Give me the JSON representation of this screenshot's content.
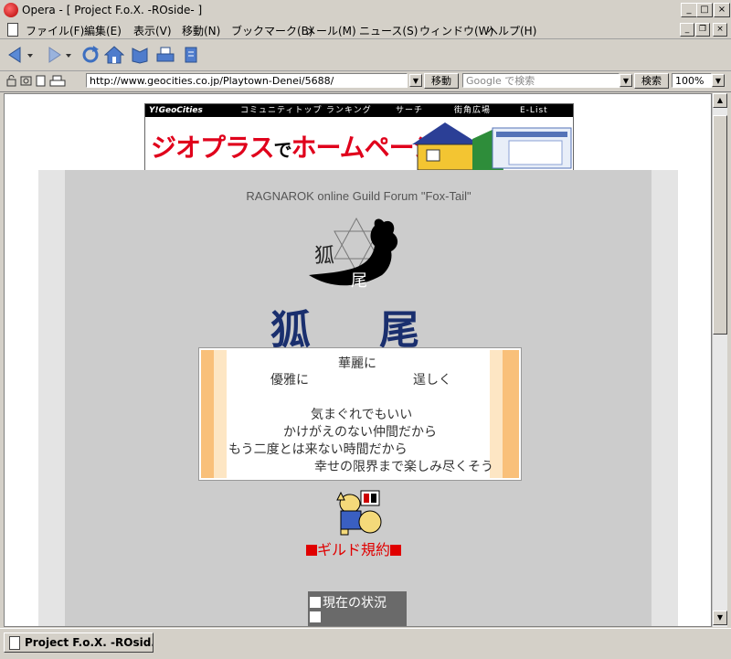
{
  "window": {
    "title": "Opera - [ Project F.o.X. -ROside- ]",
    "controls": {
      "minimize": "_",
      "maximize": "□",
      "close": "×",
      "restore": "❐"
    }
  },
  "menu": [
    "ファイル(F)",
    "編集(E)",
    "表示(V)",
    "移動(N)",
    "ブックマーク(B)",
    "メール(M)",
    "ニュース(S)",
    "ウィンドウ(W)",
    "ヘルプ(H)"
  ],
  "address": {
    "url": "http://www.geocities.co.jp/Playtown-Denei/5688/",
    "go_label": "移動",
    "search_placeholder": "Google で検索",
    "search_label": "検索",
    "zoom": "100%"
  },
  "banner": {
    "brand": "Y!GeoCities",
    "nav": [
      "コミュニティトップ",
      "ランキング",
      "サーチ",
      "街角広場",
      "E-List"
    ],
    "headline_a": "ジオプラス",
    "headline_b": "で",
    "headline_c": "ホームページ"
  },
  "page": {
    "forum_title": "RAGNAROK online Guild Forum \"Fox-Tail\"",
    "guild_name": "狐 尾",
    "poem": [
      "華麗に",
      "優雅に",
      "逞しく",
      "気まぐれでもいい",
      "かけがえのない仲間だから",
      "もう二度とは来ない時間だから",
      "幸せの限界まで楽しみ尽くそう"
    ],
    "rules_link": "ギルド規約",
    "status_link": "現在の状況"
  },
  "taskbar": {
    "tab_label": "Project F.o.X. -ROsid..."
  },
  "colors": {
    "accent_red": "#e00000",
    "kanji_blue": "#1a2f6e",
    "poem_bar": "#f9c07a"
  }
}
